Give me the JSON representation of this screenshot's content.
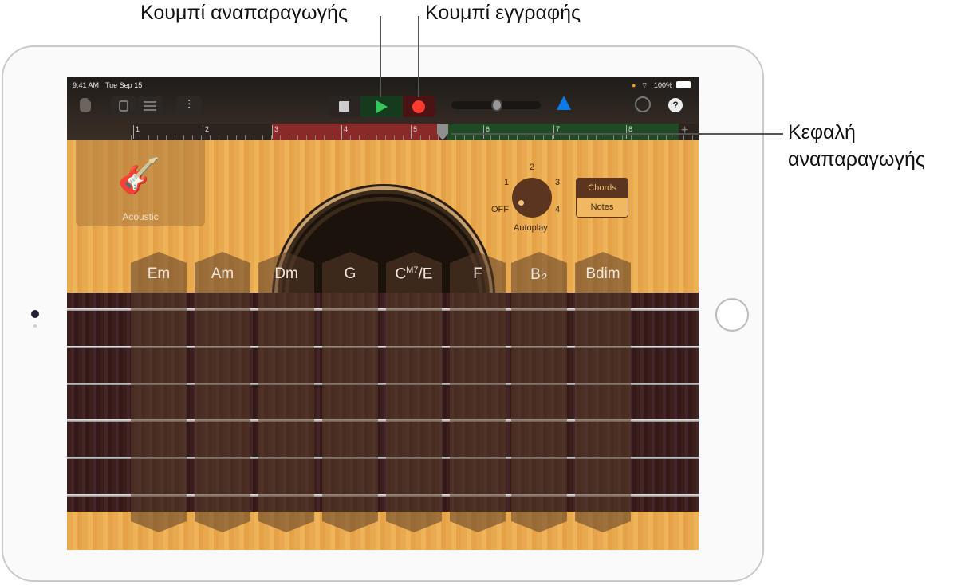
{
  "callouts": {
    "play": "Κουμπί αναπαραγωγής",
    "record": "Κουμπί εγγραφής",
    "playhead_line1": "Κεφαλή",
    "playhead_line2": "αναπαραγωγής"
  },
  "status": {
    "time": "9:41 AM",
    "date": "Tue Sep 15",
    "battery": "100%"
  },
  "toolbar": {
    "icons": [
      "document-icon",
      "tracks-view-icon",
      "list-view-icon",
      "mixer-icon",
      "stop-icon",
      "play-icon",
      "record-icon",
      "volume-slider",
      "metronome-icon",
      "settings-icon",
      "help-icon"
    ],
    "help": "?"
  },
  "ruler": {
    "bars": [
      "1",
      "2",
      "3",
      "4",
      "5",
      "6",
      "7",
      "8"
    ],
    "add": "+"
  },
  "instrument": {
    "name": "Acoustic"
  },
  "autoplay": {
    "label": "Autoplay",
    "positions": [
      "OFF",
      "1",
      "2",
      "3",
      "4"
    ],
    "selected": "OFF"
  },
  "mode": {
    "chords": "Chords",
    "notes": "Notes",
    "selected": "Chords"
  },
  "chords": [
    "Em",
    "Am",
    "Dm",
    "G",
    "C",
    "F",
    "B♭",
    "Bdim"
  ],
  "chord_sup": "M7",
  "chord_slash": "/E",
  "colors": {
    "record": "#ff3b30",
    "play": "#34c759",
    "metronome": "#0a84ff"
  }
}
